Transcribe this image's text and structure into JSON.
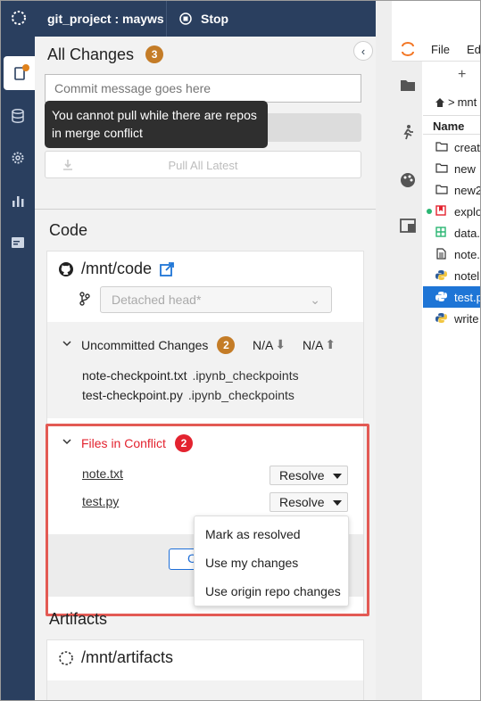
{
  "topbar": {
    "project_title": "git_project : mayws",
    "stop_label": "Stop"
  },
  "git_panel": {
    "header": "All Changes",
    "changes_count": "3",
    "commit_placeholder": "Commit message goes here",
    "tooltip": "You cannot pull while there are repos in merge conflict",
    "pull_all_label": "Pull All Latest",
    "code_section": "Code",
    "repo_path": "/mnt/code",
    "branch_placeholder": "Detached head*",
    "uncommitted_label": "Uncommitted Changes",
    "uncommitted_count": "2",
    "ahead": "N/A",
    "behind": "N/A",
    "uncommitted_files": [
      {
        "name": "note-checkpoint.txt",
        "path": ".ipynb_checkpoints"
      },
      {
        "name": "test-checkpoint.py",
        "path": ".ipynb_checkpoints"
      }
    ],
    "conflict_label": "Files in Conflict",
    "conflict_count": "2",
    "conflict_files": [
      {
        "name": "note.txt",
        "action": "Resolve"
      },
      {
        "name": "test.py",
        "action": "Resolve"
      }
    ],
    "blue_button_partial": "C",
    "resolve_menu": [
      "Mark as resolved",
      "Use my changes",
      "Use origin repo changes"
    ],
    "artifacts_section": "Artifacts",
    "artifacts_path": "/mnt/artifacts"
  },
  "jupyter": {
    "menu_file": "File",
    "menu_edit": "Ed",
    "breadcrumb": "mnt",
    "name_header": "Name",
    "files": [
      {
        "name": "creat",
        "icon": "folder-icon"
      },
      {
        "name": "new",
        "icon": "folder-icon"
      },
      {
        "name": "new2",
        "icon": "folder-icon"
      },
      {
        "name": "explo",
        "icon": "bookmark-icon"
      },
      {
        "name": "data.",
        "icon": "table-icon"
      },
      {
        "name": "note.",
        "icon": "text-file-icon"
      },
      {
        "name": "notel",
        "icon": "python-icon"
      },
      {
        "name": "test.p",
        "icon": "python-icon"
      },
      {
        "name": "write",
        "icon": "python-icon"
      }
    ]
  },
  "colors": {
    "nav": "#2a3f5f",
    "badge_orange": "#c47c27",
    "conflict_red": "#e3232f",
    "highlight": "#e35a54",
    "selected_blue": "#1e75d6"
  }
}
